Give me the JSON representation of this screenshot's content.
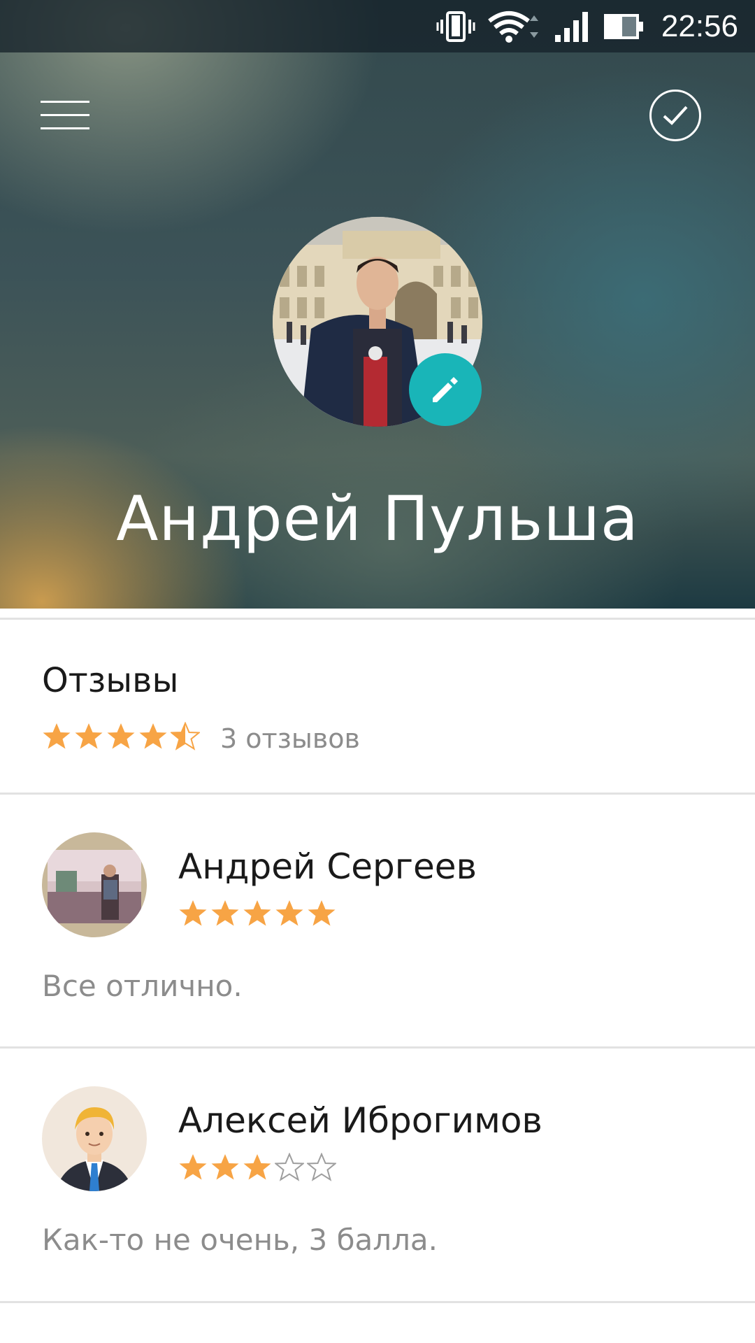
{
  "status_bar": {
    "time": "22:56",
    "icons": [
      "vibrate-icon",
      "wifi-icon",
      "signal-icon",
      "battery-icon"
    ]
  },
  "header": {
    "menu_icon": "hamburger-menu-icon",
    "confirm_icon": "check-circle-icon",
    "edit_icon": "pencil-icon",
    "profile_name": "Андрей Пульша"
  },
  "reviews_summary": {
    "title": "Отзывы",
    "rating": 4.5,
    "max_rating": 5,
    "count_text": "3 отзывов"
  },
  "reviews": [
    {
      "name": "Андрей Сергеев",
      "rating": 5,
      "text": "Все отлично."
    },
    {
      "name": "Алексей Иброгимов",
      "rating": 3,
      "text": "Как-то не очень, 3 балла."
    }
  ],
  "colors": {
    "accent": "#19b5b8",
    "star": "#f7a445",
    "star_empty": "#9e9e9e",
    "secondary_text": "#8c8c8c",
    "primary_text": "#1a1a1a",
    "divider": "#e2e2e2"
  }
}
